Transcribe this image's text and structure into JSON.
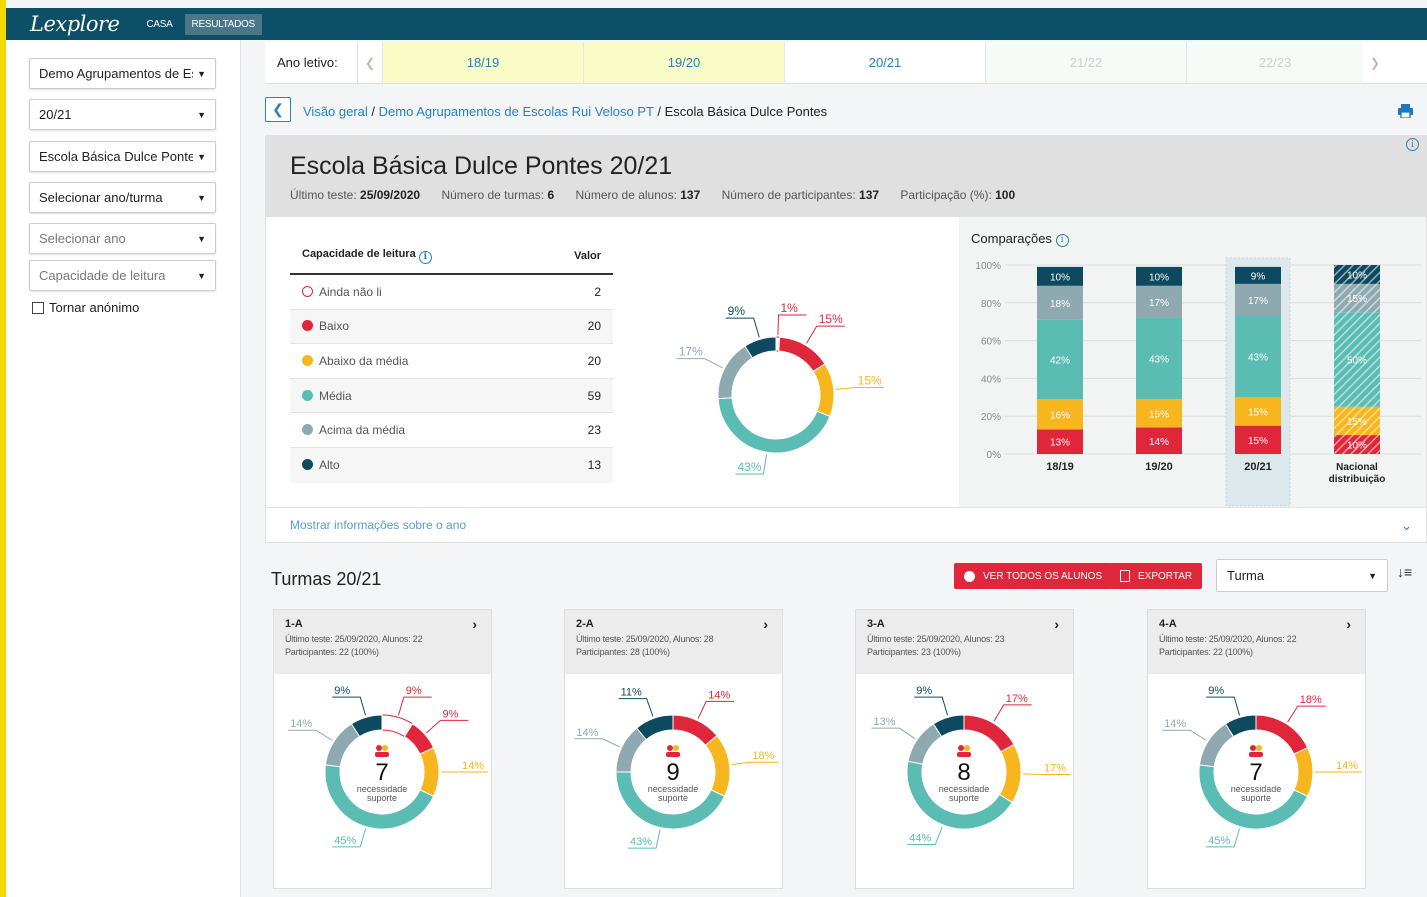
{
  "app": {
    "logo": "Lexplore",
    "nav": [
      {
        "label": "CASA"
      },
      {
        "label": "RESULTADOS"
      }
    ]
  },
  "sidebar": {
    "selects": [
      {
        "value": "Demo Agrupamentos de Es",
        "placeholder": false
      },
      {
        "value": "20/21",
        "placeholder": false
      },
      {
        "value": "Escola Básica Dulce Pontes",
        "placeholder": false
      },
      {
        "value": "Selecionar ano/turma",
        "placeholder": false
      },
      {
        "value": "Selecionar ano",
        "placeholder": true
      },
      {
        "value": "Capacidade de leitura",
        "placeholder": true
      }
    ],
    "anonymous_label": "Tornar anónimo"
  },
  "yearbar": {
    "label": "Ano letivo:",
    "tabs": [
      "18/19",
      "19/20",
      "20/21",
      "21/22",
      "22/23"
    ],
    "selected": "20/21"
  },
  "breadcrumb": {
    "items": [
      "Visão geral",
      "Demo Agrupamentos de Escolas Rui Veloso PT",
      "Escola Básica Dulce Pontes"
    ]
  },
  "school": {
    "title": "Escola Básica Dulce Pontes 20/21",
    "stats": [
      {
        "label": "Último teste: ",
        "value": "25/09/2020"
      },
      {
        "label": "Número de turmas: ",
        "value": "6"
      },
      {
        "label": "Número de alunos: ",
        "value": "137"
      },
      {
        "label": "Número de participantes: ",
        "value": "137"
      },
      {
        "label": "Participação (%): ",
        "value": "100"
      }
    ],
    "table": {
      "col1": "Capacidade de leitura",
      "col2": "Valor",
      "rows": [
        {
          "label": "Ainda não li",
          "value": "2"
        },
        {
          "label": "Baixo",
          "value": "20"
        },
        {
          "label": "Abaixo da média",
          "value": "20"
        },
        {
          "label": "Média",
          "value": "59"
        },
        {
          "label": "Acima da média",
          "value": "23"
        },
        {
          "label": "Alto",
          "value": "13"
        }
      ]
    },
    "show_more": "Mostrar informações sobre o ano"
  },
  "colors": {
    "nao_li": "#e0263a",
    "baixo": "#e0263a",
    "abaixo": "#f7b61e",
    "media": "#5bbcb4",
    "acima": "#8fa9b0",
    "alto": "#0e4a5f"
  },
  "chart_data": [
    {
      "type": "pie",
      "variant": "donut",
      "categories": [
        "Ainda não li",
        "Baixo",
        "Abaixo da média",
        "Média",
        "Acima da média",
        "Alto"
      ],
      "values": [
        1,
        15,
        15,
        43,
        17,
        9
      ],
      "labels": [
        "1%",
        "15%",
        "15%",
        "43%",
        "17%",
        "9%"
      ]
    },
    {
      "type": "bar",
      "stacked": true,
      "title": "Comparações",
      "categories": [
        "18/19",
        "19/20",
        "20/21",
        "Nacional distribuição"
      ],
      "ylim": [
        0,
        100
      ],
      "yticks": [
        "0%",
        "20%",
        "40%",
        "60%",
        "80%",
        "100%"
      ],
      "series": [
        {
          "key": "baixo",
          "values": [
            13,
            14,
            15,
            10
          ]
        },
        {
          "key": "abaixo",
          "values": [
            16,
            15,
            15,
            15
          ]
        },
        {
          "key": "media",
          "values": [
            42,
            43,
            43,
            50
          ]
        },
        {
          "key": "acima",
          "values": [
            18,
            17,
            17,
            15
          ]
        },
        {
          "key": "alto",
          "values": [
            10,
            10,
            9,
            10
          ]
        }
      ],
      "highlight": "20/21",
      "hatched": "Nacional distribuição"
    }
  ],
  "turmas": {
    "title": "Turmas 20/21",
    "btn_all": "VER TODOS OS ALUNOS",
    "btn_export": "EXPORTAR",
    "sort_select": "Turma",
    "center_label1": "necessidade",
    "center_label2": "suporte",
    "cards": [
      {
        "name": "1-A",
        "line1": "Último teste: 25/09/2020, Alunos: 22",
        "line2": "Participantes: 22 (100%)",
        "need": "7",
        "segments": [
          9,
          9,
          14,
          45,
          14,
          9
        ],
        "labels": [
          "9%",
          "9%",
          "14%",
          "45%",
          "14%",
          "9%"
        ]
      },
      {
        "name": "2-A",
        "line1": "Último teste: 25/09/2020, Alunos: 28",
        "line2": "Participantes: 28 (100%)",
        "need": "9",
        "segments": [
          0,
          14,
          18,
          43,
          14,
          11
        ],
        "labels": [
          "",
          "14%",
          "18%",
          "43%",
          "14%",
          "11%"
        ]
      },
      {
        "name": "3-A",
        "line1": "Último teste: 25/09/2020, Alunos: 23",
        "line2": "Participantes: 23 (100%)",
        "need": "8",
        "segments": [
          0,
          17,
          17,
          44,
          13,
          9
        ],
        "labels": [
          "",
          "17%",
          "17%",
          "44%",
          "13%",
          "9%"
        ]
      },
      {
        "name": "4-A",
        "line1": "Último teste: 25/09/2020, Alunos: 22",
        "line2": "Participantes: 22 (100%)",
        "need": "7",
        "segments": [
          0,
          18,
          14,
          45,
          14,
          9
        ],
        "labels": [
          "",
          "18%",
          "14%",
          "45%",
          "14%",
          "9%"
        ]
      }
    ]
  }
}
